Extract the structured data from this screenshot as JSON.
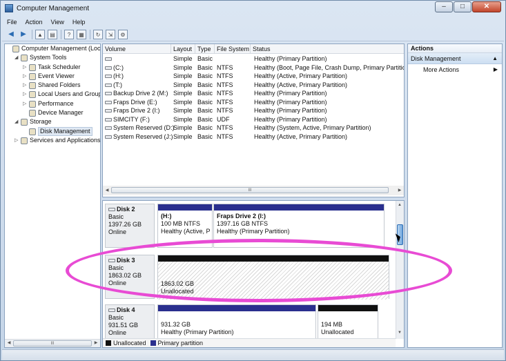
{
  "window": {
    "title": "Computer Management",
    "controls": {
      "minimize": "–",
      "maximize": "□",
      "close": "✕"
    }
  },
  "menu": [
    "File",
    "Action",
    "View",
    "Help"
  ],
  "toolbar_icons": [
    "back-icon",
    "forward-icon",
    "up-folder-icon",
    "show-hide-tree-icon",
    "help-icon",
    "properties-icon",
    "refresh-icon",
    "export-icon",
    "settings-icon"
  ],
  "tree": [
    {
      "label": "Computer Management (Local",
      "indent": 0,
      "exp": "",
      "icon": "computer-icon"
    },
    {
      "label": "System Tools",
      "indent": 1,
      "exp": "◢",
      "icon": "tools-icon"
    },
    {
      "label": "Task Scheduler",
      "indent": 2,
      "exp": "▷",
      "icon": "clock-icon"
    },
    {
      "label": "Event Viewer",
      "indent": 2,
      "exp": "▷",
      "icon": "event-viewer-icon"
    },
    {
      "label": "Shared Folders",
      "indent": 2,
      "exp": "▷",
      "icon": "shared-folder-icon"
    },
    {
      "label": "Local Users and Groups",
      "indent": 2,
      "exp": "▷",
      "icon": "users-icon"
    },
    {
      "label": "Performance",
      "indent": 2,
      "exp": "▷",
      "icon": "performance-icon"
    },
    {
      "label": "Device Manager",
      "indent": 2,
      "exp": "",
      "icon": "device-manager-icon"
    },
    {
      "label": "Storage",
      "indent": 1,
      "exp": "◢",
      "icon": "storage-icon"
    },
    {
      "label": "Disk Management",
      "indent": 2,
      "exp": "",
      "icon": "disk-management-icon",
      "selected": true
    },
    {
      "label": "Services and Applications",
      "indent": 1,
      "exp": "▷",
      "icon": "services-icon"
    }
  ],
  "tree_scroll_label": "III",
  "volume_headers": [
    "Volume",
    "Layout",
    "Type",
    "File System",
    "Status"
  ],
  "volumes": [
    [
      "",
      "Simple",
      "Basic",
      "",
      "Healthy (Primary Partition)"
    ],
    [
      "(C:)",
      "Simple",
      "Basic",
      "NTFS",
      "Healthy (Boot, Page File, Crash Dump, Primary Partition)"
    ],
    [
      "(H:)",
      "Simple",
      "Basic",
      "NTFS",
      "Healthy (Active, Primary Partition)"
    ],
    [
      "(T:)",
      "Simple",
      "Basic",
      "NTFS",
      "Healthy (Active, Primary Partition)"
    ],
    [
      "Backup Drive 2 (M:)",
      "Simple",
      "Basic",
      "NTFS",
      "Healthy (Primary Partition)"
    ],
    [
      "Fraps Drive (E:)",
      "Simple",
      "Basic",
      "NTFS",
      "Healthy (Primary Partition)"
    ],
    [
      "Fraps Drive 2 (I:)",
      "Simple",
      "Basic",
      "NTFS",
      "Healthy (Primary Partition)"
    ],
    [
      "SIMCITY (F:)",
      "Simple",
      "Basic",
      "UDF",
      "Healthy (Primary Partition)"
    ],
    [
      "System Reserved (D:)",
      "Simple",
      "Basic",
      "NTFS",
      "Healthy (System, Active, Primary Partition)"
    ],
    [
      "System Reserved (J:)",
      "Simple",
      "Basic",
      "NTFS",
      "Healthy (Active, Primary Partition)"
    ]
  ],
  "volume_scroll_label": "III",
  "disks": [
    {
      "name": "Disk 2",
      "type": "Basic",
      "size": "1397.26 GB",
      "state": "Online",
      "partitions": [
        {
          "name": "(H:)",
          "size": "100 MB NTFS",
          "status": "Healthy (Active, P",
          "kind": "primary"
        },
        {
          "name": "Fraps Drive 2  (I:)",
          "size": "1397.16 GB NTFS",
          "status": "Healthy (Primary Partition)",
          "kind": "primary"
        }
      ]
    },
    {
      "name": "Disk 3",
      "type": "Basic",
      "size": "1863.02 GB",
      "state": "Online",
      "partitions": [
        {
          "name": "",
          "size": "1863.02 GB",
          "status": "Unallocated",
          "kind": "unallocated"
        }
      ]
    },
    {
      "name": "Disk 4",
      "type": "Basic",
      "size": "931.51 GB",
      "state": "Online",
      "partitions": [
        {
          "name": "",
          "size": "931.32 GB",
          "status": "Healthy (Primary Partition)",
          "kind": "primary"
        },
        {
          "name": "",
          "size": "194 MB",
          "status": "Unallocated",
          "kind": "unallocated"
        }
      ]
    }
  ],
  "legend": [
    {
      "label": "Unallocated",
      "color": "#111111"
    },
    {
      "label": "Primary partition",
      "color": "#2a2f8e"
    }
  ],
  "actions": {
    "title": "Actions",
    "section": "Disk Management",
    "items": [
      "More Actions"
    ]
  },
  "colors": {
    "primary_bar": "#2a2f8e",
    "unallocated_bar": "#111111",
    "highlight_ellipse": "#e84bd4"
  }
}
